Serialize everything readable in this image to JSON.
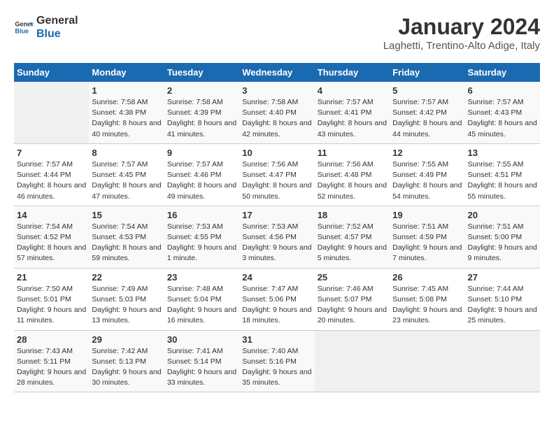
{
  "header": {
    "logo_general": "General",
    "logo_blue": "Blue",
    "month": "January 2024",
    "location": "Laghetti, Trentino-Alto Adige, Italy"
  },
  "weekdays": [
    "Sunday",
    "Monday",
    "Tuesday",
    "Wednesday",
    "Thursday",
    "Friday",
    "Saturday"
  ],
  "weeks": [
    [
      null,
      {
        "day": 1,
        "sunrise": "7:58 AM",
        "sunset": "4:38 PM",
        "daylight": "8 hours and 40 minutes."
      },
      {
        "day": 2,
        "sunrise": "7:58 AM",
        "sunset": "4:39 PM",
        "daylight": "8 hours and 41 minutes."
      },
      {
        "day": 3,
        "sunrise": "7:58 AM",
        "sunset": "4:40 PM",
        "daylight": "8 hours and 42 minutes."
      },
      {
        "day": 4,
        "sunrise": "7:57 AM",
        "sunset": "4:41 PM",
        "daylight": "8 hours and 43 minutes."
      },
      {
        "day": 5,
        "sunrise": "7:57 AM",
        "sunset": "4:42 PM",
        "daylight": "8 hours and 44 minutes."
      },
      {
        "day": 6,
        "sunrise": "7:57 AM",
        "sunset": "4:43 PM",
        "daylight": "8 hours and 45 minutes."
      }
    ],
    [
      {
        "day": 7,
        "sunrise": "7:57 AM",
        "sunset": "4:44 PM",
        "daylight": "8 hours and 46 minutes."
      },
      {
        "day": 8,
        "sunrise": "7:57 AM",
        "sunset": "4:45 PM",
        "daylight": "8 hours and 47 minutes."
      },
      {
        "day": 9,
        "sunrise": "7:57 AM",
        "sunset": "4:46 PM",
        "daylight": "8 hours and 49 minutes."
      },
      {
        "day": 10,
        "sunrise": "7:56 AM",
        "sunset": "4:47 PM",
        "daylight": "8 hours and 50 minutes."
      },
      {
        "day": 11,
        "sunrise": "7:56 AM",
        "sunset": "4:48 PM",
        "daylight": "8 hours and 52 minutes."
      },
      {
        "day": 12,
        "sunrise": "7:55 AM",
        "sunset": "4:49 PM",
        "daylight": "8 hours and 54 minutes."
      },
      {
        "day": 13,
        "sunrise": "7:55 AM",
        "sunset": "4:51 PM",
        "daylight": "8 hours and 55 minutes."
      }
    ],
    [
      {
        "day": 14,
        "sunrise": "7:54 AM",
        "sunset": "4:52 PM",
        "daylight": "8 hours and 57 minutes."
      },
      {
        "day": 15,
        "sunrise": "7:54 AM",
        "sunset": "4:53 PM",
        "daylight": "8 hours and 59 minutes."
      },
      {
        "day": 16,
        "sunrise": "7:53 AM",
        "sunset": "4:55 PM",
        "daylight": "9 hours and 1 minute."
      },
      {
        "day": 17,
        "sunrise": "7:53 AM",
        "sunset": "4:56 PM",
        "daylight": "9 hours and 3 minutes."
      },
      {
        "day": 18,
        "sunrise": "7:52 AM",
        "sunset": "4:57 PM",
        "daylight": "9 hours and 5 minutes."
      },
      {
        "day": 19,
        "sunrise": "7:51 AM",
        "sunset": "4:59 PM",
        "daylight": "9 hours and 7 minutes."
      },
      {
        "day": 20,
        "sunrise": "7:51 AM",
        "sunset": "5:00 PM",
        "daylight": "9 hours and 9 minutes."
      }
    ],
    [
      {
        "day": 21,
        "sunrise": "7:50 AM",
        "sunset": "5:01 PM",
        "daylight": "9 hours and 11 minutes."
      },
      {
        "day": 22,
        "sunrise": "7:49 AM",
        "sunset": "5:03 PM",
        "daylight": "9 hours and 13 minutes."
      },
      {
        "day": 23,
        "sunrise": "7:48 AM",
        "sunset": "5:04 PM",
        "daylight": "9 hours and 16 minutes."
      },
      {
        "day": 24,
        "sunrise": "7:47 AM",
        "sunset": "5:06 PM",
        "daylight": "9 hours and 18 minutes."
      },
      {
        "day": 25,
        "sunrise": "7:46 AM",
        "sunset": "5:07 PM",
        "daylight": "9 hours and 20 minutes."
      },
      {
        "day": 26,
        "sunrise": "7:45 AM",
        "sunset": "5:08 PM",
        "daylight": "9 hours and 23 minutes."
      },
      {
        "day": 27,
        "sunrise": "7:44 AM",
        "sunset": "5:10 PM",
        "daylight": "9 hours and 25 minutes."
      }
    ],
    [
      {
        "day": 28,
        "sunrise": "7:43 AM",
        "sunset": "5:11 PM",
        "daylight": "9 hours and 28 minutes."
      },
      {
        "day": 29,
        "sunrise": "7:42 AM",
        "sunset": "5:13 PM",
        "daylight": "9 hours and 30 minutes."
      },
      {
        "day": 30,
        "sunrise": "7:41 AM",
        "sunset": "5:14 PM",
        "daylight": "9 hours and 33 minutes."
      },
      {
        "day": 31,
        "sunrise": "7:40 AM",
        "sunset": "5:16 PM",
        "daylight": "9 hours and 35 minutes."
      },
      null,
      null,
      null
    ]
  ]
}
